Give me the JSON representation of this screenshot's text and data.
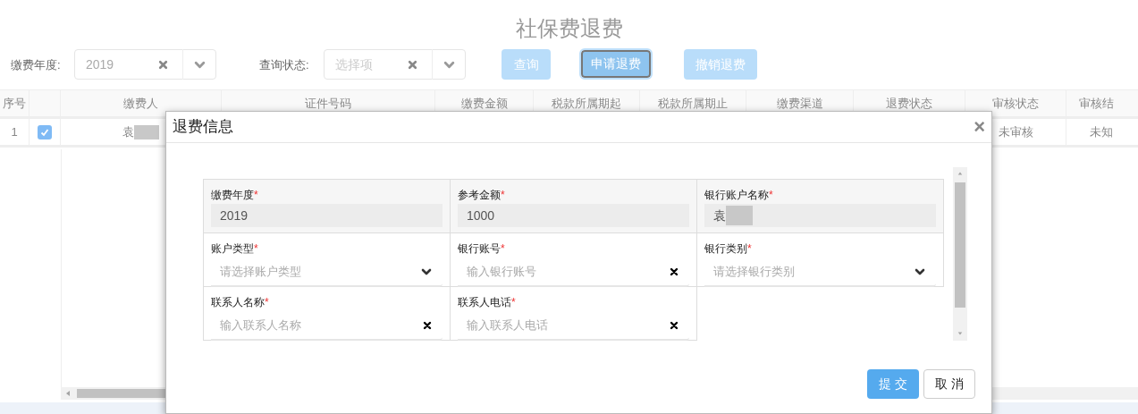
{
  "page_title": "社保费退费",
  "filters": [
    {
      "label": "缴费年度:",
      "value": "2019"
    },
    {
      "label": "查询状态:",
      "placeholder": "选择项"
    }
  ],
  "toolbar_buttons": [
    {
      "label": "查询",
      "focused": false
    },
    {
      "label": "申请退费",
      "focused": true
    },
    {
      "label": "撤销退费",
      "focused": false
    }
  ],
  "table": {
    "columns": [
      "序号",
      "缴费人",
      "证件号码",
      "缴费金额",
      "税款所属期起",
      "税款所属期止",
      "缴费渠道",
      "退费状态",
      "审核状态",
      "审核结"
    ],
    "rows": [
      {
        "number": "1",
        "selected": true,
        "payer": "袁",
        "payer_redacted": true,
        "audit_status": "未审核",
        "audit_result": "未知"
      }
    ]
  },
  "dialog": {
    "title": "退费信息",
    "close": "×",
    "required_mark": "*",
    "fields": [
      {
        "kind": "readonly",
        "label": "缴费年度",
        "required": true,
        "value": "2019"
      },
      {
        "kind": "readonly",
        "label": "参考金额",
        "required": true,
        "value": "1000"
      },
      {
        "kind": "readonly",
        "label": "银行账户名称",
        "required": true,
        "value": "袁",
        "redacted": true
      },
      {
        "kind": "select",
        "label": "账户类型",
        "required": true,
        "placeholder": "请选择账户类型"
      },
      {
        "kind": "input",
        "label": "银行账号",
        "required": true,
        "placeholder": "输入银行账号"
      },
      {
        "kind": "select",
        "label": "银行类别",
        "required": true,
        "placeholder": "请选择银行类别"
      },
      {
        "kind": "input",
        "label": "联系人名称",
        "required": true,
        "placeholder": "输入联系人名称"
      },
      {
        "kind": "input",
        "label": "联系人电话",
        "required": true,
        "placeholder": "输入联系人电话"
      }
    ],
    "buttons": [
      {
        "label": "提 交",
        "kind": "primary"
      },
      {
        "label": "取 消",
        "kind": "default"
      }
    ]
  }
}
